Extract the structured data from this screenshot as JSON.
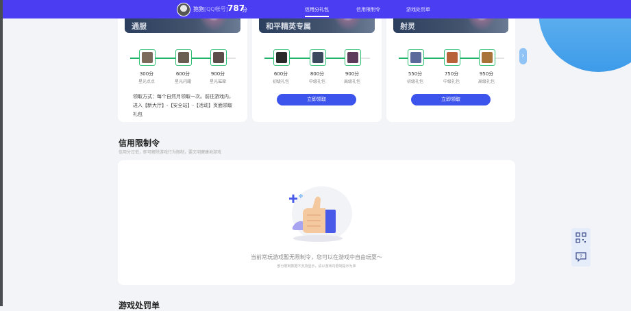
{
  "topbar": {
    "username": "狍狍",
    "account_type": "[QQ帐号]",
    "score": "787",
    "score_unit": "分",
    "nav": [
      "信用分礼包",
      "信用限制令",
      "游戏处罚单"
    ]
  },
  "cards": [
    {
      "banner_title": "通服",
      "rewards": [
        {
          "points": "300分",
          "name": "星光点点",
          "color": "#7c6a5a"
        },
        {
          "points": "600分",
          "name": "星光闪耀",
          "color": "#6a5d52"
        },
        {
          "points": "900分",
          "name": "星光璀璨",
          "color": "#5a4d4a"
        }
      ],
      "note": "领取方式：每个自然月领取一次。前往游戏内，进入【新大厅】-【安全站】-【活动】页面领取礼包"
    },
    {
      "banner_title": "和平精英专属",
      "rewards": [
        {
          "points": "600分",
          "name": "初级礼包",
          "color": "#2a2a2a"
        },
        {
          "points": "800分",
          "name": "中级礼包",
          "color": "#3b4a5c"
        },
        {
          "points": "900分",
          "name": "高级礼包",
          "color": "#5e3a5a"
        }
      ],
      "button": "立即领取"
    },
    {
      "banner_title": "射灵",
      "rewards": [
        {
          "points": "550分",
          "name": "初级礼包",
          "color": "#5a6a9a"
        },
        {
          "points": "750分",
          "name": "中级礼包",
          "color": "#b8623a"
        },
        {
          "points": "950分",
          "name": "高级礼包",
          "color": "#a8743a"
        }
      ],
      "button": "立即领取"
    }
  ],
  "restriction": {
    "title": "信用限制令",
    "subtitle": "信用分过低，即可解除游戏行为限制，要文明健康地游戏",
    "empty_main": "当前常玩游戏暂无限制令，您可以在游戏中自由玩耍～",
    "empty_sub": "部分限制数据不支持显示，请以游戏内限制提示为准"
  },
  "penalty": {
    "title": "游戏处罚单"
  }
}
